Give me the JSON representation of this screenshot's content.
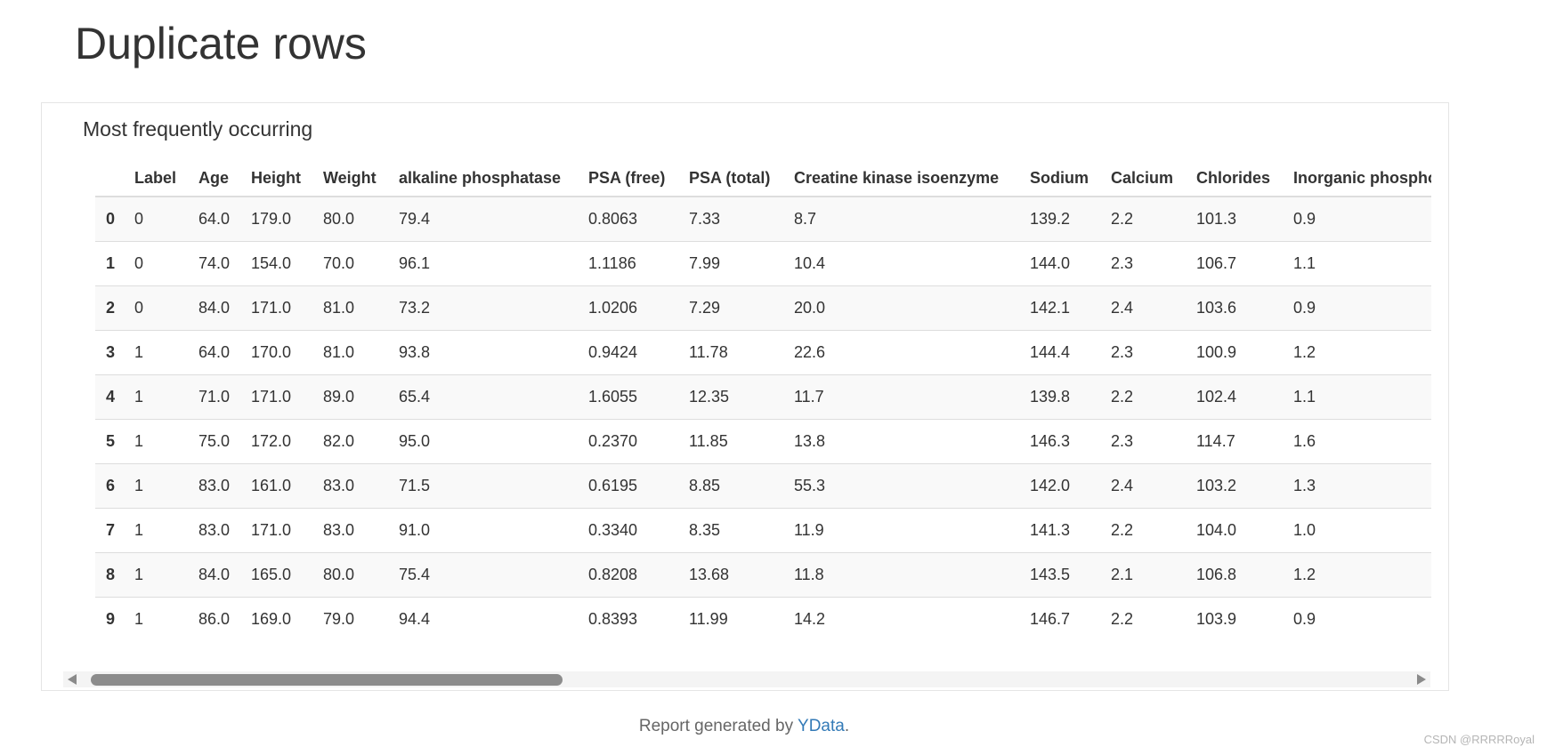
{
  "page": {
    "title": "Duplicate rows"
  },
  "panel": {
    "heading": "Most frequently occurring"
  },
  "table": {
    "columns": [
      "",
      "Label",
      "Age",
      "Height",
      "Weight",
      "alkaline phosphatase",
      "PSA (free)",
      "PSA (total)",
      "Creatine kinase isoenzyme",
      "Sodium",
      "Calcium",
      "Chlorides",
      "Inorganic phosphorus"
    ],
    "rows": [
      [
        "0",
        "0",
        "64.0",
        "179.0",
        "80.0",
        "79.4",
        "0.8063",
        "7.33",
        "8.7",
        "139.2",
        "2.2",
        "101.3",
        "0.9"
      ],
      [
        "1",
        "0",
        "74.0",
        "154.0",
        "70.0",
        "96.1",
        "1.1186",
        "7.99",
        "10.4",
        "144.0",
        "2.3",
        "106.7",
        "1.1"
      ],
      [
        "2",
        "0",
        "84.0",
        "171.0",
        "81.0",
        "73.2",
        "1.0206",
        "7.29",
        "20.0",
        "142.1",
        "2.4",
        "103.6",
        "0.9"
      ],
      [
        "3",
        "1",
        "64.0",
        "170.0",
        "81.0",
        "93.8",
        "0.9424",
        "11.78",
        "22.6",
        "144.4",
        "2.3",
        "100.9",
        "1.2"
      ],
      [
        "4",
        "1",
        "71.0",
        "171.0",
        "89.0",
        "65.4",
        "1.6055",
        "12.35",
        "11.7",
        "139.8",
        "2.2",
        "102.4",
        "1.1"
      ],
      [
        "5",
        "1",
        "75.0",
        "172.0",
        "82.0",
        "95.0",
        "0.2370",
        "11.85",
        "13.8",
        "146.3",
        "2.3",
        "114.7",
        "1.6"
      ],
      [
        "6",
        "1",
        "83.0",
        "161.0",
        "83.0",
        "71.5",
        "0.6195",
        "8.85",
        "55.3",
        "142.0",
        "2.4",
        "103.2",
        "1.3"
      ],
      [
        "7",
        "1",
        "83.0",
        "171.0",
        "83.0",
        "91.0",
        "0.3340",
        "8.35",
        "11.9",
        "141.3",
        "2.2",
        "104.0",
        "1.0"
      ],
      [
        "8",
        "1",
        "84.0",
        "165.0",
        "80.0",
        "75.4",
        "0.8208",
        "13.68",
        "11.8",
        "143.5",
        "2.1",
        "106.8",
        "1.2"
      ],
      [
        "9",
        "1",
        "86.0",
        "169.0",
        "79.0",
        "94.4",
        "0.8393",
        "11.99",
        "14.2",
        "146.7",
        "2.2",
        "103.9",
        "0.9"
      ]
    ]
  },
  "footer": {
    "prefix": "Report generated by ",
    "link_text": "YData",
    "suffix": "."
  },
  "watermark": "CSDN @RRRRRoyal",
  "colors": {
    "link": "#337ab7",
    "scrollbar_thumb": "#8c8c8c",
    "row_stripe": "#f9f9f9"
  }
}
